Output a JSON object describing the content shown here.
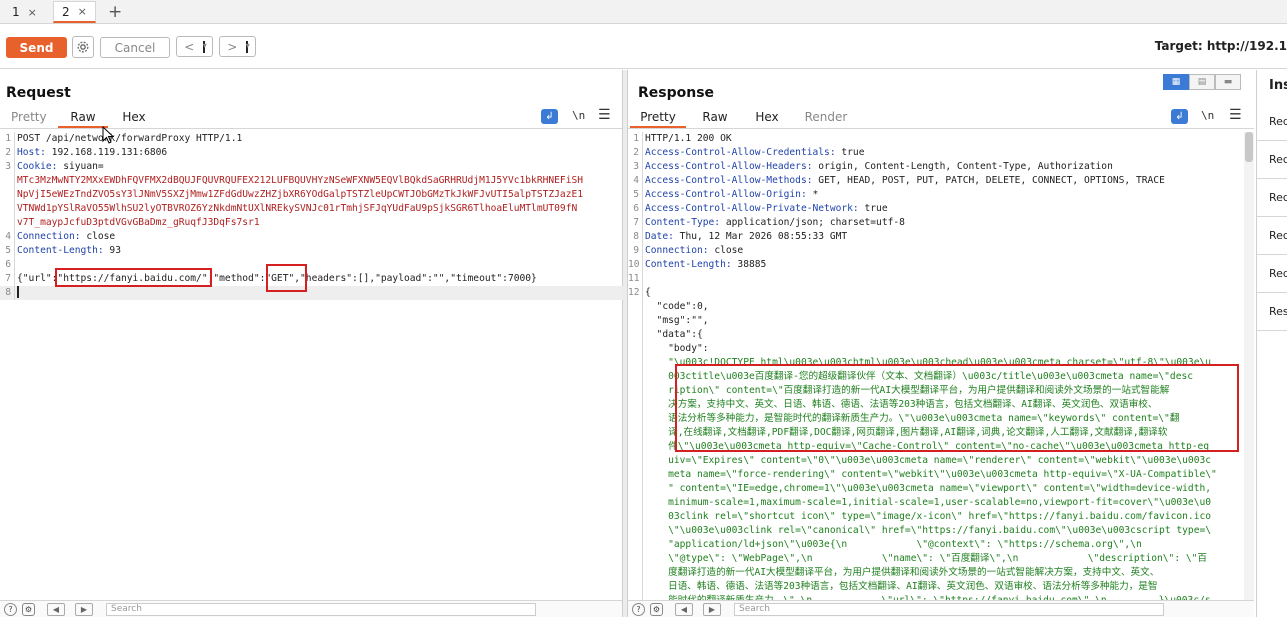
{
  "tabs": [
    {
      "label": "1",
      "close": "×"
    },
    {
      "label": "2",
      "close": "×"
    }
  ],
  "tab_add": "+",
  "toolbar": {
    "send_label": "Send",
    "cancel_label": "Cancel",
    "back_label": "<",
    "forward_label": ">",
    "dropdown_caret": "▾",
    "target_label": "Target: http://192.1"
  },
  "request": {
    "title": "Request",
    "subtabs": [
      "Pretty",
      "Raw",
      "Hex"
    ],
    "active_subtab": "Raw",
    "newline_label": "\\n",
    "lines": [
      {
        "n": "1",
        "text": "POST /api/network/forwardProxy HTTP/1.1"
      },
      {
        "n": "2",
        "key": "Host:",
        "value": " 192.168.119.131:6806"
      },
      {
        "n": "3",
        "key": "Cookie:",
        "value": " siyuan="
      },
      {
        "n": "",
        "value": "MTc3MzMwNTY2MXxEWDhFQVFMX2dBQUJFQUVRQUFEX212LUFBQUVHYzNSeWFXNW5EQVlBQkdSaGRHRUdjM1J5YVc1bkRHNEFiSH"
      },
      {
        "n": "",
        "value": "NpVjI5eWEzTndZVO5sY3lJNmV5SXZjMmw1ZFdGdUwzZHZjbXR6YOdGalpTSTZleUpCWTJObGMzTkJkWFJvUTI5alpTSTZJazE1"
      },
      {
        "n": "",
        "value": "VTNWd1pYSlRaVO55WlhSU2lyOTBVROZ6YzNkdmNtUXlNREkySVNJc01rTmhjSFJqYUdFaU9pSjkSGR6TlhoaEluMTlmUT09fN"
      },
      {
        "n": "",
        "value": "v7T_maypJcfuD3ptdVGvGBaDmz_gRuqfJ3DqFs7sr1"
      },
      {
        "n": "4",
        "key": "Connection:",
        "value": " close"
      },
      {
        "n": "5",
        "key": "Content-Length:",
        "value": " 93"
      },
      {
        "n": "6",
        "text": ""
      },
      {
        "n": "7",
        "text": "{\"url\":\"https://fanyi.baidu.com/\",\"method\":\"GET\",\"headers\":[],\"payload\":\"\",\"timeout\":7000}"
      },
      {
        "n": "8",
        "text": ""
      }
    ]
  },
  "response": {
    "title": "Response",
    "subtabs": [
      "Pretty",
      "Raw",
      "Hex",
      "Render"
    ],
    "active_subtab": "Pretty",
    "newline_label": "\\n",
    "lines": [
      {
        "n": "1",
        "text": "HTTP/1.1 200 OK"
      },
      {
        "n": "2",
        "key": "Access-Control-Allow-Credentials:",
        "value": " true"
      },
      {
        "n": "3",
        "key": "Access-Control-Allow-Headers:",
        "value": " origin, Content-Length, Content-Type, Authorization"
      },
      {
        "n": "4",
        "key": "Access-Control-Allow-Methods:",
        "value": " GET, HEAD, POST, PUT, PATCH, DELETE, CONNECT, OPTIONS, TRACE"
      },
      {
        "n": "5",
        "key": "Access-Control-Allow-Origin:",
        "value": " *"
      },
      {
        "n": "6",
        "key": "Access-Control-Allow-Private-Network:",
        "value": " true"
      },
      {
        "n": "7",
        "key": "Content-Type:",
        "value": " application/json; charset=utf-8"
      },
      {
        "n": "8",
        "key": "Date:",
        "value": " Thu, 12 Mar 2026 08:55:33 GMT"
      },
      {
        "n": "9",
        "key": "Connection:",
        "value": " close"
      },
      {
        "n": "10",
        "key": "Content-Length:",
        "value": " 38885"
      },
      {
        "n": "11",
        "text": ""
      },
      {
        "n": "12",
        "text": "{"
      },
      {
        "n": "",
        "text": "  \"code\":0,"
      },
      {
        "n": "",
        "text": "  \"msg\":\"\","
      },
      {
        "n": "",
        "text": "  \"data\":{"
      },
      {
        "n": "",
        "text": "    \"body\":"
      },
      {
        "n": "",
        "green": "    \"\\u003c!DOCTYPE html\\u003e\\u003chtml\\u003e\\u003chead\\u003e\\u003cmeta charset=\\\"utf-8\\\"\\u003e\\u"
      },
      {
        "n": "",
        "green": "    003ctitle\\u003e百度翻译-您的超级翻译伙伴（文本、文档翻译）\\u003c/title\\u003e\\u003cmeta name=\\\"desc"
      },
      {
        "n": "",
        "green": "    ription\\\" content=\\\"百度翻译打造的新一代AI大模型翻译平台，为用户提供翻译和阅读外文场景的一站式智能解"
      },
      {
        "n": "",
        "green": "    决方案，支持中文、英文、日语、韩语、德语、法语等203种语言，包括文档翻译、AI翻译、英文润色、双语审校、"
      },
      {
        "n": "",
        "green": "    语法分析等多种能力，是智能时代的翻译新质生产力。\\\"\\u003e\\u003cmeta name=\\\"keywords\\\" content=\\\"翻"
      },
      {
        "n": "",
        "green": "    译,在线翻译,文档翻译,PDF翻译,DOC翻译,网页翻译,图片翻译,AI翻译,词典,论文翻译,人工翻译,文献翻译,翻译软"
      },
      {
        "n": "",
        "green": "    件\\\"\\u003e\\u003cmeta http-equiv=\\\"Cache-Control\\\" content=\\\"no-cache\\\"\\u003e\\u003cmeta http-eq"
      },
      {
        "n": "",
        "green": "    uiv=\\\"Expires\\\" content=\\\"0\\\"\\u003e\\u003cmeta name=\\\"renderer\\\" content=\\\"webkit\\\"\\u003e\\u003c"
      },
      {
        "n": "",
        "green": "    meta name=\\\"force-rendering\\\" content=\\\"webkit\\\"\\u003e\\u003cmeta http-equiv=\\\"X-UA-Compatible\\\""
      },
      {
        "n": "",
        "green": "    \" content=\\\"IE=edge,chrome=1\\\"\\u003e\\u003cmeta name=\\\"viewport\\\" content=\\\"width=device-width,"
      },
      {
        "n": "",
        "green": "    minimum-scale=1,maximum-scale=1,initial-scale=1,user-scalable=no,viewport-fit=cover\\\"\\u003e\\u0"
      },
      {
        "n": "",
        "green": "    03clink rel=\\\"shortcut icon\\\" type=\\\"image/x-icon\\\" href=\\\"https://fanyi.baidu.com/favicon.ico"
      },
      {
        "n": "",
        "green": "    \\\"\\u003e\\u003clink rel=\\\"canonical\\\" href=\\\"https://fanyi.baidu.com\\\"\\u003e\\u003cscript type=\\"
      },
      {
        "n": "",
        "green": "    \"application/ld+json\\\"\\u003e{\\n            \\\"@context\\\": \\\"https://schema.org\\\",\\n"
      },
      {
        "n": "",
        "green": "    \\\"@type\\\": \\\"WebPage\\\",\\n            \\\"name\\\": \\\"百度翻译\\\",\\n            \\\"description\\\": \\\"百"
      },
      {
        "n": "",
        "green": "    度翻译打造的新一代AI大模型翻译平台，为用户提供翻译和阅读外文场景的一站式智能解决方案，支持中文、英文、"
      },
      {
        "n": "",
        "green": "    日语、韩语、德语、法语等203种语言，包括文档翻译、AI翻译、英文润色、双语审校、语法分析等多种能力，是智"
      },
      {
        "n": "",
        "green": "    能时代的翻译新质生产力。\\\",\\n            \\\"url\\\": \\\"https://fanyi.baidu.com\\\",\\n         }\\u003c/s"
      }
    ]
  },
  "inspector": {
    "title": "Ins",
    "items": [
      "Req",
      "Req",
      "Req",
      "Req",
      "Req",
      "Res"
    ]
  },
  "bottom": {
    "search_placeholder": "Search"
  }
}
